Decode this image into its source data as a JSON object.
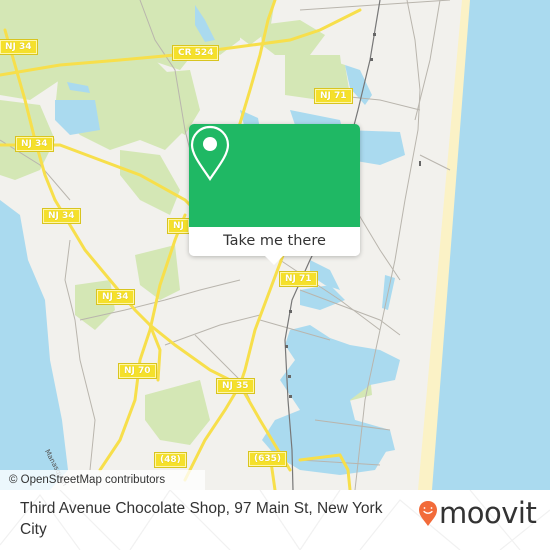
{
  "map": {
    "colors": {
      "land": "#f2f1ed",
      "water": "#aadaef",
      "park": "#cfe6ae",
      "beach": "#fbf2c6",
      "highway": "#f7df4b",
      "road_minor": "#b9b5ad",
      "rail": "#777777"
    },
    "route_shields": [
      {
        "label": "NJ 34",
        "id": "nj34-top"
      },
      {
        "label": "CR 524",
        "id": "cr524"
      },
      {
        "label": "NJ 34",
        "id": "nj34-mid"
      },
      {
        "label": "NJ 34",
        "id": "nj34-left"
      },
      {
        "label": "NJ",
        "id": "nj-partial"
      },
      {
        "label": "NJ 34",
        "id": "nj34-lower"
      },
      {
        "label": "NJ 70",
        "id": "nj70"
      },
      {
        "label": "NJ 35",
        "id": "nj35"
      },
      {
        "label": "NJ 71",
        "id": "nj71-top"
      },
      {
        "label": "NJ 71",
        "id": "nj71-mid"
      },
      {
        "label": "(48)",
        "id": "cr48"
      },
      {
        "label": "(635)",
        "id": "cr635"
      }
    ],
    "street_labels": [
      {
        "label": "Manasquan"
      }
    ],
    "attribution": "© OpenStreetMap contributors"
  },
  "popup": {
    "icon": "map-pin-icon",
    "button_label": "Take me there",
    "color": "#1fb864"
  },
  "footer": {
    "address": "Third Avenue Chocolate Shop, 97 Main St, New York City",
    "brand": {
      "name": "moovit",
      "icon": "moovit-pin-icon",
      "pin_color": "#f26b3a"
    }
  }
}
